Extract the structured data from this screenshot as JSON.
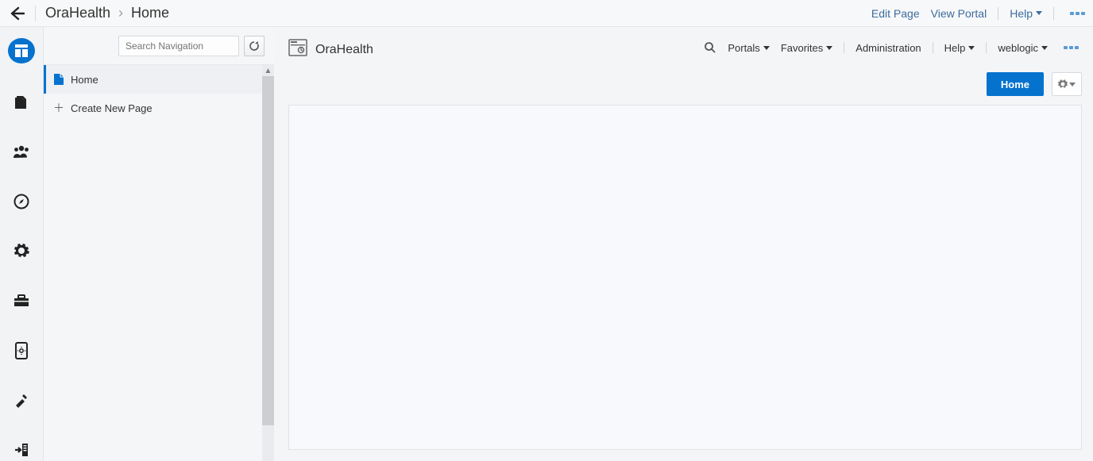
{
  "topbar": {
    "breadcrumb": {
      "root": "OraHealth",
      "current": "Home"
    },
    "links": {
      "edit": "Edit Page",
      "view": "View Portal",
      "help": "Help"
    }
  },
  "navpanel": {
    "search_placeholder": "Search Navigation",
    "items": [
      {
        "label": "Home"
      }
    ],
    "create_label": "Create New Page"
  },
  "main": {
    "title": "OraHealth",
    "nav": {
      "portals": "Portals",
      "favorites": "Favorites",
      "admin": "Administration",
      "help": "Help",
      "user": "weblogic"
    },
    "home_button": "Home"
  }
}
